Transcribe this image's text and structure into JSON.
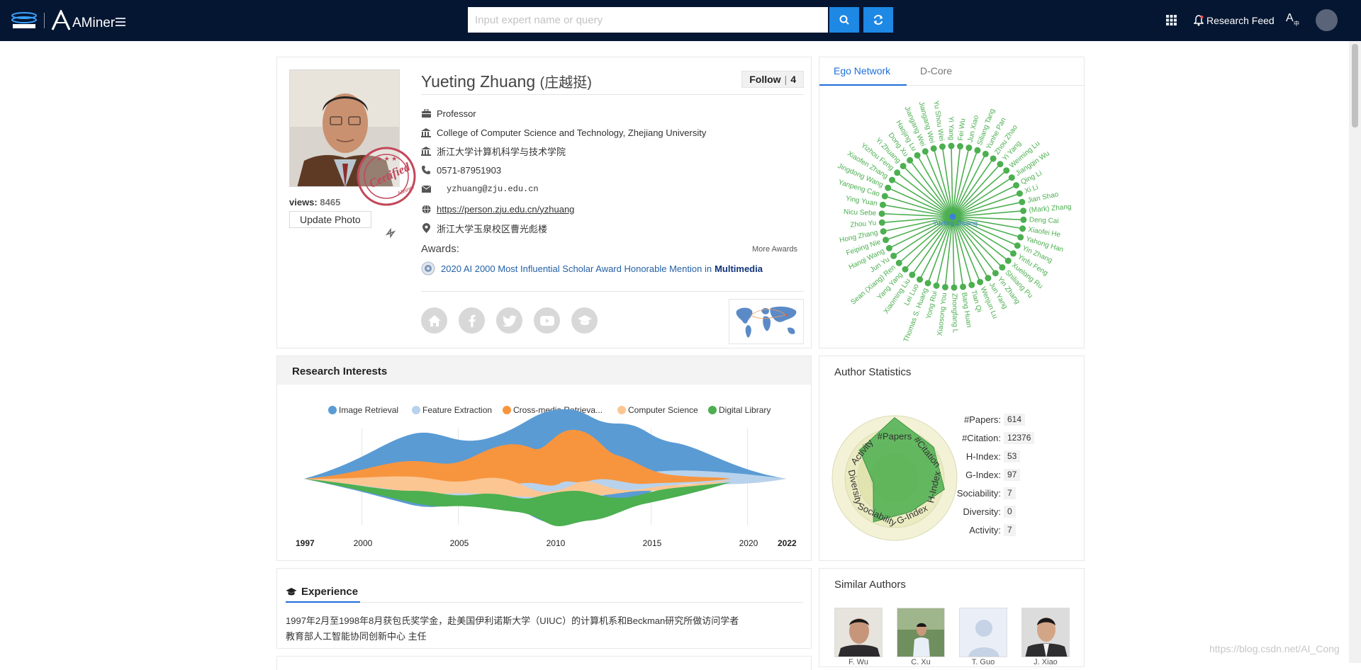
{
  "header": {
    "brand": "AMiner",
    "search_placeholder": "Input expert name or query",
    "research_feed": "Research Feed"
  },
  "profile": {
    "name": "Yueting Zhuang",
    "name_cn": "(庄越挺)",
    "follow_label": "Follow",
    "follow_count": "4",
    "views_label": "views:",
    "views": "8465",
    "update_photo": "Update Photo",
    "title": "Professor",
    "affiliation": "College of Computer Science and Technology, Zhejiang University",
    "affiliation_cn": "浙江大学计算机科学与技术学院",
    "phone": "0571-87951903",
    "email": "yzhuang@zju.edu.cn",
    "homepage": "https://person.zju.edu.cn/yzhuang",
    "address": "浙江大学玉泉校区曹光彪楼",
    "awards_title": "Awards:",
    "more_awards": "More Awards",
    "award_text": "2020 AI 2000 Most Influential Scholar Award Honorable Mention in",
    "award_field": "Multimedia",
    "stamp_text": "Certified",
    "stamp_sub": "AMiner"
  },
  "ego": {
    "tabs": [
      "Ego Network",
      "D-Core"
    ],
    "center": "Yueting Zhuang",
    "nodes": [
      "Yi Yang",
      "Fei Wu",
      "Jun Xiao",
      "Siliang Tang",
      "Yunhe Pan",
      "Zhou Zhao",
      "Yi Yang",
      "Weiming Lu",
      "Jiangqin Wu",
      "Qing Li",
      "Xi Li",
      "Jian Shao",
      "(Mark) Zhang",
      "Deng Cai",
      "Xiaofei He",
      "Yahong Han",
      "Yin Zhang",
      "Yinfu Feng",
      "Xuelong Ru",
      "Shiliang Pu",
      "Yin Zhang",
      "Jun Yang",
      "Wenjun Lu",
      "Tian Qi",
      "Bang Huan",
      "Zhongfang L",
      "Xiaosong You",
      "Yong Rui",
      "Thomas S. Huang",
      "Lei Luo",
      "Xiaoming Liu",
      "Yang Yang",
      "Sean (Xiang) Ren",
      "Jun Yu",
      "Hanqi Wang",
      "Feiping Nie",
      "Hong Zhang",
      "Zhou Yu",
      "Nicu Sebe",
      "Ying Yuan",
      "Yanpeng Cao",
      "Jingdong Wang",
      "Xiaofen Zhang",
      "Yizhou Feng",
      "Yi Zhuang",
      "Dong Xu",
      "Haojing Lu",
      "Jiangang Wei",
      "Jiangang Wei",
      "Yu Shou Wei"
    ]
  },
  "research_interests": {
    "title": "Research Interests",
    "chart_data": {
      "type": "area",
      "x_start": 1997,
      "x_end": 2022,
      "x_ticks": [
        "1997",
        "2000",
        "2005",
        "2010",
        "2015",
        "2020",
        "2022"
      ],
      "series": [
        {
          "name": "Image Retrieval",
          "color": "#5a9bd4"
        },
        {
          "name": "Feature Extraction",
          "color": "#b8d2ec"
        },
        {
          "name": "Cross-media Retrieva...",
          "color": "#f7953f"
        },
        {
          "name": "Computer Science",
          "color": "#fcc693"
        },
        {
          "name": "Digital Library",
          "color": "#4caf50"
        }
      ]
    }
  },
  "stats": {
    "title": "Author Statistics",
    "rows": [
      {
        "label": "#Papers:",
        "value": "614"
      },
      {
        "label": "#Citation:",
        "value": "12376"
      },
      {
        "label": "H-Index:",
        "value": "53"
      },
      {
        "label": "G-Index:",
        "value": "97"
      },
      {
        "label": "Sociability:",
        "value": "7"
      },
      {
        "label": "Diversity:",
        "value": "0"
      },
      {
        "label": "Activity:",
        "value": "7"
      }
    ],
    "radar_axes": [
      "#Papers",
      "#Citation",
      "H-Index",
      "G-Index",
      "Sociability",
      "Diversity",
      "Activity"
    ]
  },
  "experience": {
    "title": "Experience",
    "lines": [
      "1997年2月至1998年8月获包氏奖学金，赴美国伊利诺斯大学（UIUC）的计算机系和Beckman研究所做访问学者",
      "教育部人工智能协同创新中心 主任"
    ]
  },
  "similar": {
    "title": "Similar Authors",
    "authors": [
      "F. Wu",
      "C. Xu",
      "T. Guo",
      "J. Xiao"
    ]
  },
  "watermark": "https://blog.csdn.net/AI_Cong"
}
